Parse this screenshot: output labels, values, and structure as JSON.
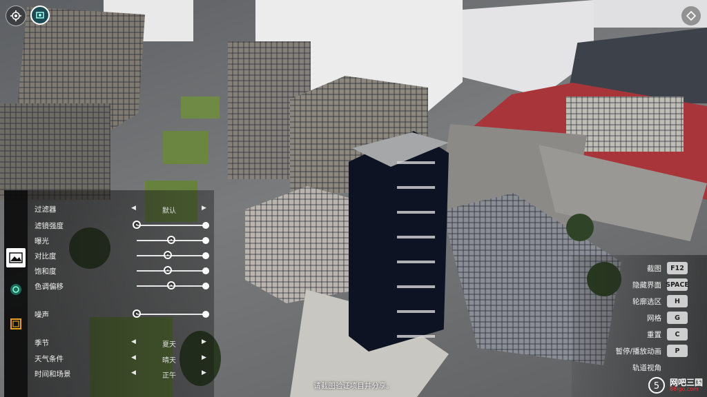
{
  "filters_panel": {
    "filter_label": "过滤器",
    "filter_value": "默认",
    "sliders": [
      {
        "label": "滤镜强度",
        "value": 0.0
      },
      {
        "label": "曝光",
        "value": 0.5
      },
      {
        "label": "对比度",
        "value": 0.45
      },
      {
        "label": "饱和度",
        "value": 0.45
      },
      {
        "label": "色调偏移",
        "value": 0.5
      }
    ],
    "noise": {
      "label": "噪声",
      "value": 0.0
    },
    "selectors": [
      {
        "label": "季节",
        "value": "夏天"
      },
      {
        "label": "天气条件",
        "value": "晴天"
      },
      {
        "label": "时间和场景",
        "value": "正午"
      }
    ]
  },
  "shortcuts": [
    {
      "label": "截图",
      "key": "F12"
    },
    {
      "label": "隐藏界面",
      "key": "SPACE"
    },
    {
      "label": "轮廓选区",
      "key": "H"
    },
    {
      "label": "网格",
      "key": "G"
    },
    {
      "label": "重置",
      "key": "C"
    },
    {
      "label": "暂停/播放动画",
      "key": "P"
    },
    {
      "label": "轨道视角",
      "key": ""
    }
  ],
  "bottom_message": "请截图验证项目并分享。",
  "watermark": {
    "brand": "网吧三国",
    "url": "88igo.com"
  },
  "colors": {
    "accent": "#ffffff",
    "panel": "#141414",
    "roof_red": "#a8353a",
    "tower": "#0d1322"
  }
}
